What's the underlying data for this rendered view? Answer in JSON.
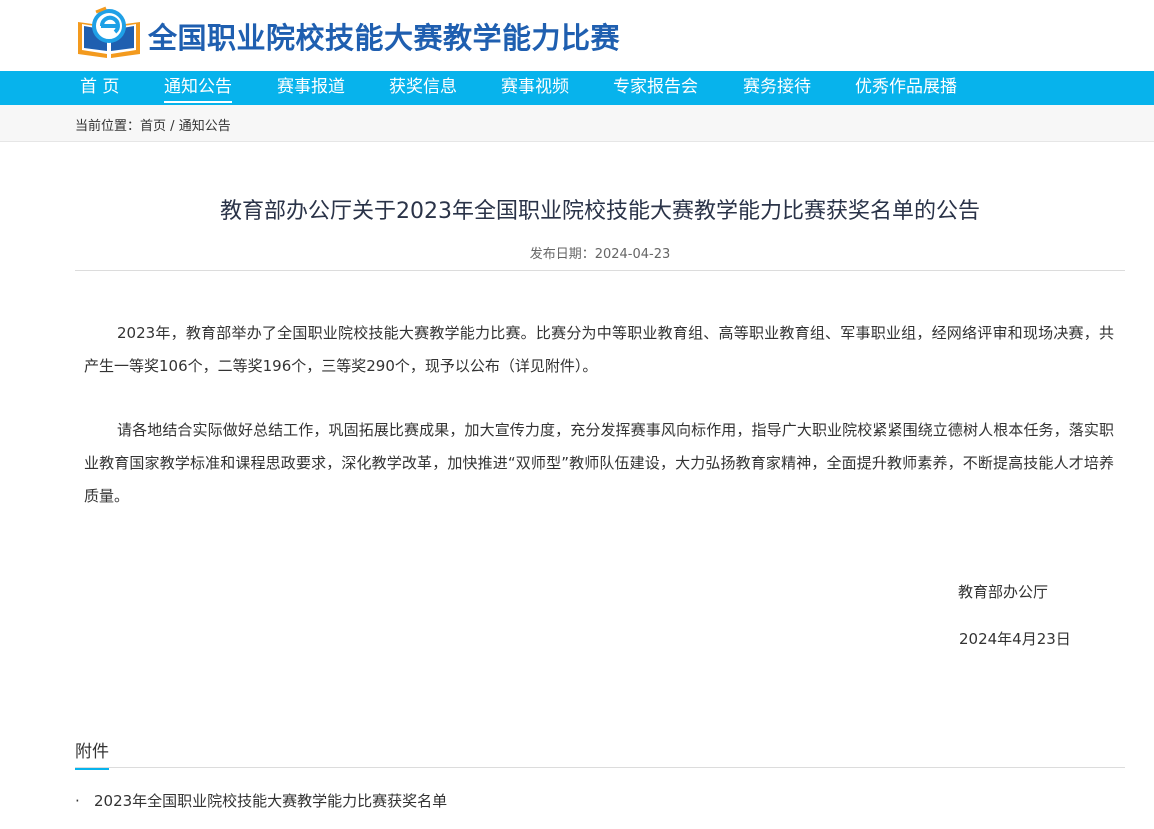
{
  "header": {
    "site_title": "全国职业院校技能大赛教学能力比赛"
  },
  "nav": {
    "items": [
      {
        "label": "首 页"
      },
      {
        "label": "通知公告",
        "active": true
      },
      {
        "label": "赛事报道"
      },
      {
        "label": "获奖信息"
      },
      {
        "label": "赛事视频"
      },
      {
        "label": "专家报告会"
      },
      {
        "label": "赛务接待"
      },
      {
        "label": "优秀作品展播"
      }
    ]
  },
  "breadcrumb": {
    "prefix": "当前位置：",
    "home": "首页",
    "separator": " / ",
    "current": "通知公告"
  },
  "article": {
    "title": "教育部办公厅关于2023年全国职业院校技能大赛教学能力比赛获奖名单的公告",
    "publish_date": "发布日期：2024-04-23",
    "paragraphs": [
      "2023年，教育部举办了全国职业院校技能大赛教学能力比赛。比赛分为中等职业教育组、高等职业教育组、军事职业组，经网络评审和现场决赛，共产生一等奖106个，二等奖196个，三等奖290个，现予以公布（详见附件）。",
      "请各地结合实际做好总结工作，巩固拓展比赛成果，加大宣传力度，充分发挥赛事风向标作用，指导广大职业院校紧紧围绕立德树人根本任务，落实职业教育国家教学标准和课程思政要求，深化教学改革，加快推进“双师型”教师队伍建设，大力弘扬教育家精神，全面提升教师素养，不断提高技能人才培养质量。"
    ],
    "signature_org": "教育部办公厅",
    "signature_date": "2024年4月23日"
  },
  "attachments": {
    "title": "附件",
    "bullet": "·",
    "items": [
      {
        "label": "2023年全国职业院校技能大赛教学能力比赛获奖名单"
      }
    ]
  },
  "colors": {
    "nav_bg": "#07b3ec",
    "title_blue": "#1f5fb0",
    "logo_orange": "#f39a1e"
  }
}
